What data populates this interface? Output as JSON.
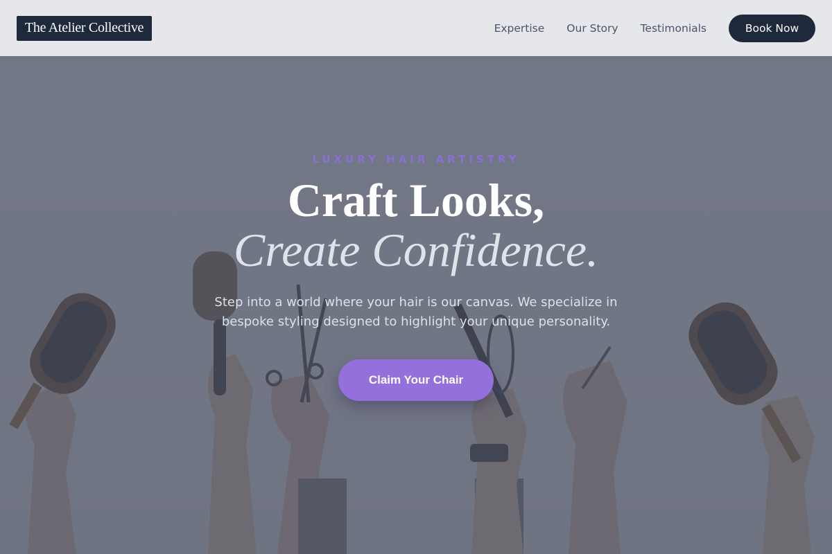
{
  "nav": {
    "brand": "The Atelier Collective",
    "links": [
      "Expertise",
      "Our Story",
      "Testimonials"
    ],
    "cta": "Book Now"
  },
  "hero": {
    "eyebrow": "LUXURY HAIR ARTISTRY",
    "headline_line1": "Craft Looks,",
    "headline_line2": "Create Confidence.",
    "subtext": "Step into a world where your hair is our canvas. We specialize in bespoke styling designed to highlight your unique personality.",
    "cta": "Claim Your Chair",
    "image_description_icon": "hands-holding-hair-tools-photo"
  },
  "colors": {
    "brand_bg": "#1e293b",
    "accent": "#9370db",
    "nav_bg": "#e5e7eb",
    "overlay": "#4b5063"
  }
}
